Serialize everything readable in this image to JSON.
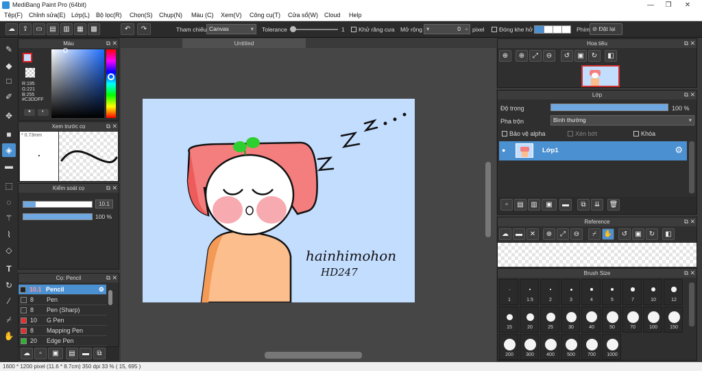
{
  "window": {
    "title": "MediBang Paint Pro (64bit)"
  },
  "menu": [
    "Tệp(F)",
    "Chỉnh sửa(E)",
    "Lớp(L)",
    "Bộ lọc(R)",
    "Chọn(S)",
    "Chụp(N)",
    "Màu (C)",
    "Xem(V)",
    "Công cụ(T)",
    "Cửa sổ(W)",
    "Cloud",
    "Help"
  ],
  "toolbar": {
    "ref_label": "Tham chiếu",
    "ref_value": "Canvas",
    "tol_label": "Tolerance",
    "tol_value": "1",
    "antialias_label": "Khử răng cưa",
    "expand_label": "Mở rộng",
    "expand_value": "0",
    "pixel_label": "pixel",
    "close_gap_label": "Đóng khe hở",
    "key_label": "Phím",
    "reset_label": "Đặt lại"
  },
  "color_panel": {
    "title": "Màu",
    "r": "R:195",
    "g": "G:221",
    "b": "B:255",
    "hex": "#C3DDFF"
  },
  "brush_preview": {
    "title": "Xem trước cọ",
    "size": "0.73mm"
  },
  "brush_control": {
    "title": "Kiểm soát cọ",
    "size": "10.1",
    "opacity": "100 %"
  },
  "brush_list": {
    "title": "Cọ: Pencil",
    "items": [
      {
        "size": "10.1",
        "name": "Pencil",
        "color": "#222222"
      },
      {
        "size": "8",
        "name": "Pen",
        "color": "#333333"
      },
      {
        "size": "8",
        "name": "Pen (Sharp)",
        "color": "#333333"
      },
      {
        "size": "10",
        "name": "G Pen",
        "color": "#e03030"
      },
      {
        "size": "8",
        "name": "Mapping Pen",
        "color": "#e03030"
      },
      {
        "size": "20",
        "name": "Edge Pen",
        "color": "#30b030"
      }
    ]
  },
  "document": {
    "tab": "Untitled",
    "signature_line1": "hainhimohon",
    "signature_line2": "HD247"
  },
  "navigator": {
    "title": "Hoa tiêu"
  },
  "layer_panel": {
    "title": "Lớp",
    "opacity_label": "Độ trong",
    "opacity_value": "100 %",
    "blend_label": "Pha trộn",
    "blend_value": "Bình thường",
    "protect_alpha": "Bảo vệ alpha",
    "clipping": "Xén bớt",
    "lock": "Khóa",
    "layer_name": "Lớp1"
  },
  "reference": {
    "title": "Reference"
  },
  "brush_size": {
    "title": "Brush Size",
    "sizes": [
      "1",
      "1.5",
      "2",
      "3",
      "4",
      "5",
      "7",
      "10",
      "12",
      "15",
      "20",
      "25",
      "30",
      "40",
      "50",
      "70",
      "100",
      "150",
      "200",
      "300",
      "400",
      "500",
      "700",
      "1000"
    ]
  },
  "status": "1600 * 1200 pixel   (11.6 * 8.7cm)  350 dpi  33 %   ( 15, 695 )",
  "colors": {
    "canvas_bg": "#C3DDFF",
    "hat": "#f47e7e",
    "skin": "#fbbe8c",
    "sprout": "#2ecf2e",
    "accent": "#4b90d0"
  }
}
